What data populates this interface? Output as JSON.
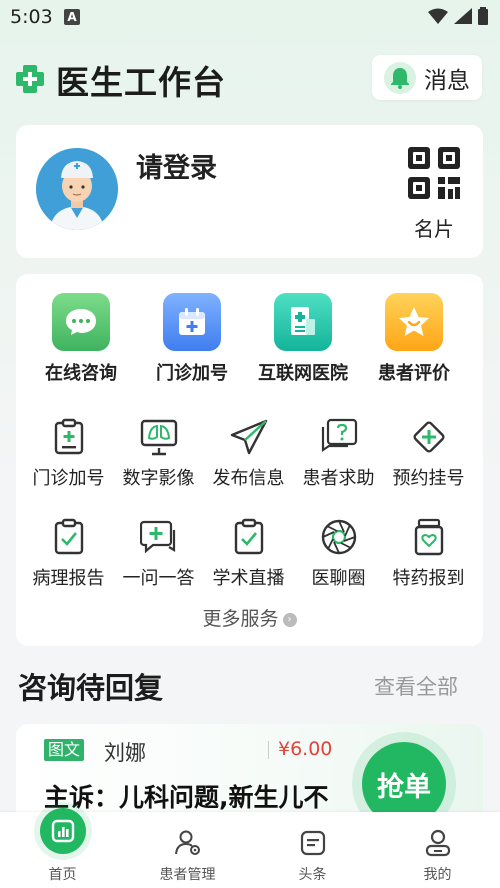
{
  "status_bar": {
    "time": "5:03",
    "notif": "A"
  },
  "header": {
    "title": "医生工作台",
    "message_label": "消息"
  },
  "profile": {
    "login_text": "请登录",
    "card_label": "名片"
  },
  "featured_services": [
    {
      "label": "在线咨询",
      "icon": "chat-bubble-icon",
      "color": "#4cc06a"
    },
    {
      "label": "门诊加号",
      "icon": "calendar-plus-icon",
      "color": "#4a8cf0"
    },
    {
      "label": "互联网医院",
      "icon": "hospital-doc-icon",
      "color": "#1fbfa6"
    },
    {
      "label": "患者评价",
      "icon": "star-smile-icon",
      "color": "#ffb21e"
    }
  ],
  "services": [
    {
      "label": "门诊加号",
      "icon": "clipboard-plus-icon"
    },
    {
      "label": "数字影像",
      "icon": "lung-monitor-icon"
    },
    {
      "label": "发布信息",
      "icon": "paper-plane-icon"
    },
    {
      "label": "患者求助",
      "icon": "help-chat-icon"
    },
    {
      "label": "预约挂号",
      "icon": "diamond-plus-icon"
    },
    {
      "label": "病理报告",
      "icon": "clipboard-check-icon"
    },
    {
      "label": "一问一答",
      "icon": "chat-plus-icon"
    },
    {
      "label": "学术直播",
      "icon": "clipboard-check-icon"
    },
    {
      "label": "医聊圈",
      "icon": "aperture-icon"
    },
    {
      "label": "特药报到",
      "icon": "medicine-jar-icon"
    }
  ],
  "more_services": "更多服务",
  "pending": {
    "title": "咨询待回复",
    "view_all": "查看全部",
    "card": {
      "tag": "图文",
      "patient": "刘娜",
      "price": "¥6.00",
      "complaint": "主诉：儿科问题,新生儿不",
      "grab_label": "抢单"
    }
  },
  "nav": [
    {
      "label": "首页",
      "icon": "home-chart-icon",
      "active": true
    },
    {
      "label": "患者管理",
      "icon": "patient-manage-icon",
      "active": false
    },
    {
      "label": "头条",
      "icon": "news-icon",
      "active": false
    },
    {
      "label": "我的",
      "icon": "profile-icon",
      "active": false
    }
  ],
  "colors": {
    "accent": "#22b862",
    "price": "#e0443a"
  }
}
